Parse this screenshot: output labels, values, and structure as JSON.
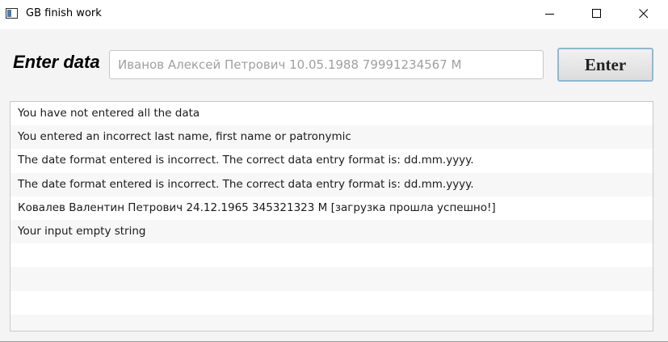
{
  "window": {
    "title": "GB finish work",
    "icon": "app-window-icon",
    "controls": {
      "minimize": "minimize-icon",
      "maximize": "maximize-icon",
      "close": "close-icon"
    }
  },
  "form": {
    "label": "Enter data",
    "input_value": "",
    "input_placeholder": "Иванов Алексей Петрович 10.05.1988 79991234567 М",
    "enter_label": "Enter"
  },
  "log": {
    "items": [
      "You have not entered all the data",
      "You entered an incorrect last name, first name or patronymic",
      "The date format entered is incorrect. The correct data entry format is: dd.mm.yyyy.",
      "The date format entered is incorrect. The correct data entry format is: dd.mm.yyyy.",
      "Ковалев Валентин Петрович 24.12.1965 345321323 М  [загрузка прошла успешно!]",
      "Your input empty string",
      "",
      "",
      "",
      ""
    ]
  },
  "colors": {
    "window_bg": "#f4f4f4",
    "button_border": "#8fb9d1",
    "row_alt": "#f7f7f7"
  }
}
